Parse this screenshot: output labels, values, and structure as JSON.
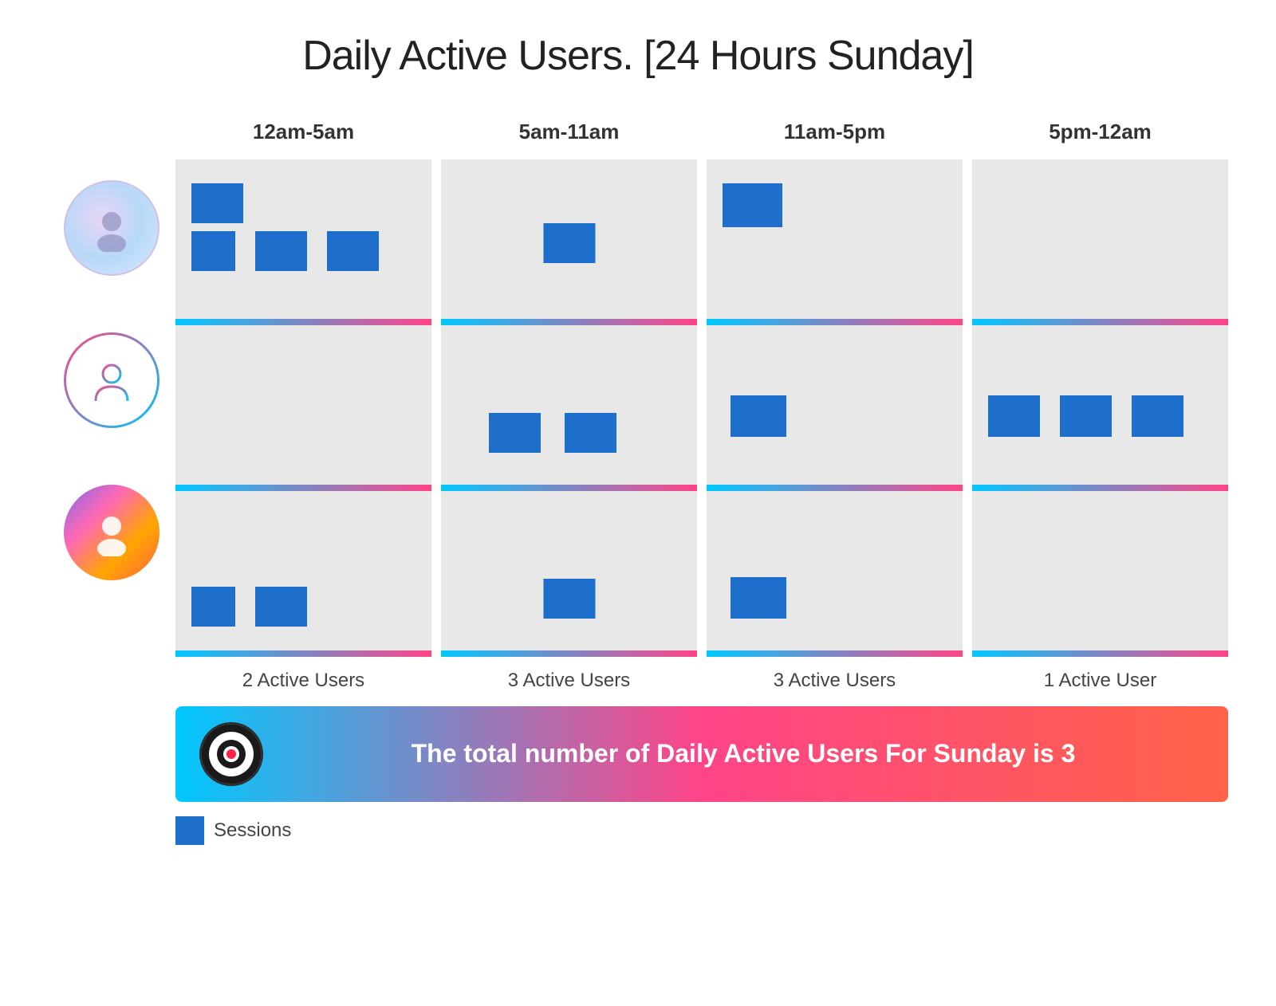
{
  "title": "Daily Active Users. [24 Hours Sunday]",
  "time_periods": [
    {
      "id": "12am-5am",
      "label": "12am-5am"
    },
    {
      "id": "5am-11am",
      "label": "5am-11am"
    },
    {
      "id": "11am-5pm",
      "label": "11am-5pm"
    },
    {
      "id": "5pm-12am",
      "label": "5pm-12am"
    }
  ],
  "active_user_counts": [
    "2 Active Users",
    "3 Active Users",
    "3 Active Users",
    "1 Active User"
  ],
  "summary": {
    "text": "The total number of Daily Active Users For Sunday is 3"
  },
  "legend": {
    "label": "Sessions"
  },
  "colors": {
    "session_block": "#1e6fcc",
    "cell_bg": "#e8e8e8",
    "divider_start": "#00c8ff",
    "divider_end": "#ff4488"
  }
}
